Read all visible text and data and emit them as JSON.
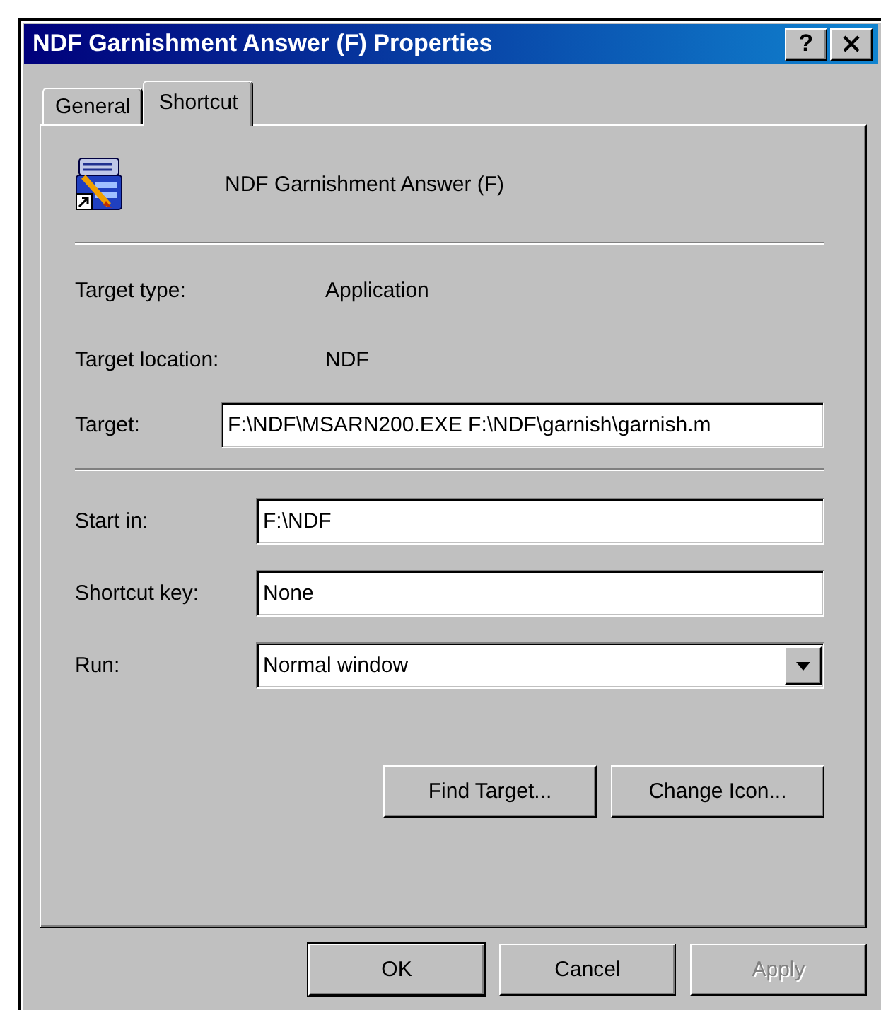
{
  "window": {
    "title": "NDF Garnishment Answer (F) Properties",
    "help": "?"
  },
  "tabs": [
    {
      "label": "General",
      "selected": false
    },
    {
      "label": "Shortcut",
      "selected": true
    }
  ],
  "shortcut": {
    "name": "NDF Garnishment Answer (F)",
    "info": [
      {
        "label": "Target type:",
        "value": "Application"
      },
      {
        "label": "Target location:",
        "value": "NDF"
      }
    ],
    "target": {
      "label": "Target:",
      "value": "F:\\NDF\\MSARN200.EXE F:\\NDF\\garnish\\garnish.m"
    },
    "fields": [
      {
        "kind": "text",
        "label": "Start in:",
        "value": "F:\\NDF"
      },
      {
        "kind": "text",
        "label": "Shortcut key:",
        "value": "None"
      },
      {
        "kind": "dropdown",
        "label": "Run:",
        "value": "Normal window"
      }
    ],
    "buttons": [
      {
        "label": "Find Target..."
      },
      {
        "label": "Change Icon..."
      }
    ]
  },
  "dialog_buttons": [
    {
      "label": "OK",
      "disabled": false,
      "default": true
    },
    {
      "label": "Cancel",
      "disabled": false,
      "default": false
    },
    {
      "label": "Apply",
      "disabled": true,
      "default": false
    }
  ]
}
